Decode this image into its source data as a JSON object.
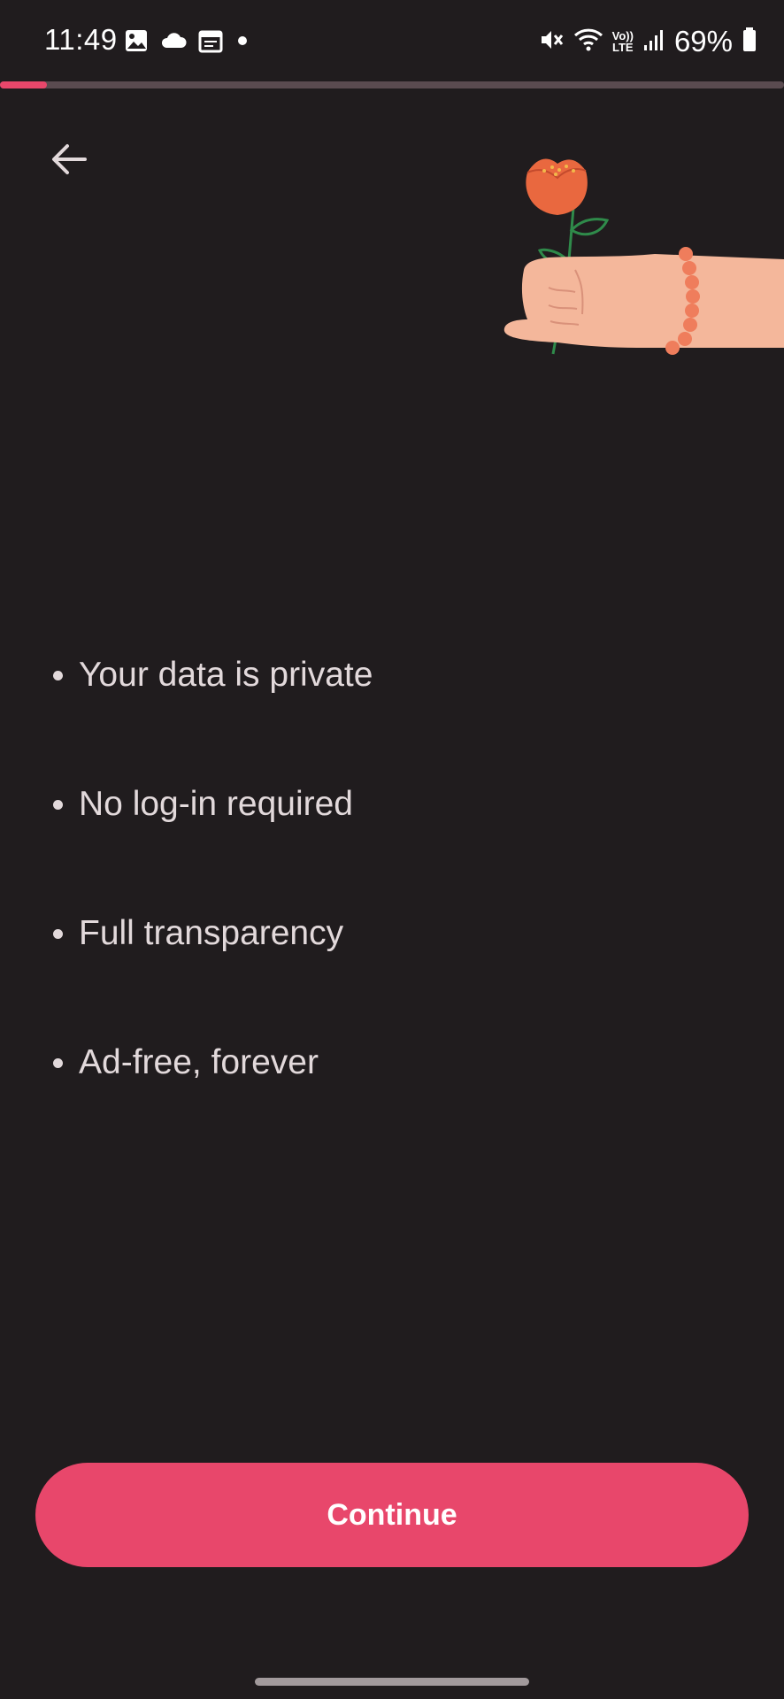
{
  "status_bar": {
    "time": "11:49",
    "battery": "69%",
    "volte_label_top": "Vo))",
    "volte_label_bottom": "LTE",
    "icons": [
      "gallery-icon",
      "cloud-icon",
      "calendar-icon",
      "dot-icon",
      "mute-icon",
      "wifi-icon",
      "volte-icon",
      "signal-icon",
      "battery-icon"
    ]
  },
  "onboarding": {
    "progress": 0.06,
    "back_icon": "arrow-left-icon",
    "illustration": "hand-holding-flower",
    "features": [
      "Your data is private",
      "No log-in required",
      "Full transparency",
      "Ad-free, forever"
    ],
    "continue_label": "Continue"
  },
  "colors": {
    "background": "#201c1e",
    "accent": "#e8476b",
    "progress_track": "#5a4b50",
    "text": "#e2d9db"
  }
}
